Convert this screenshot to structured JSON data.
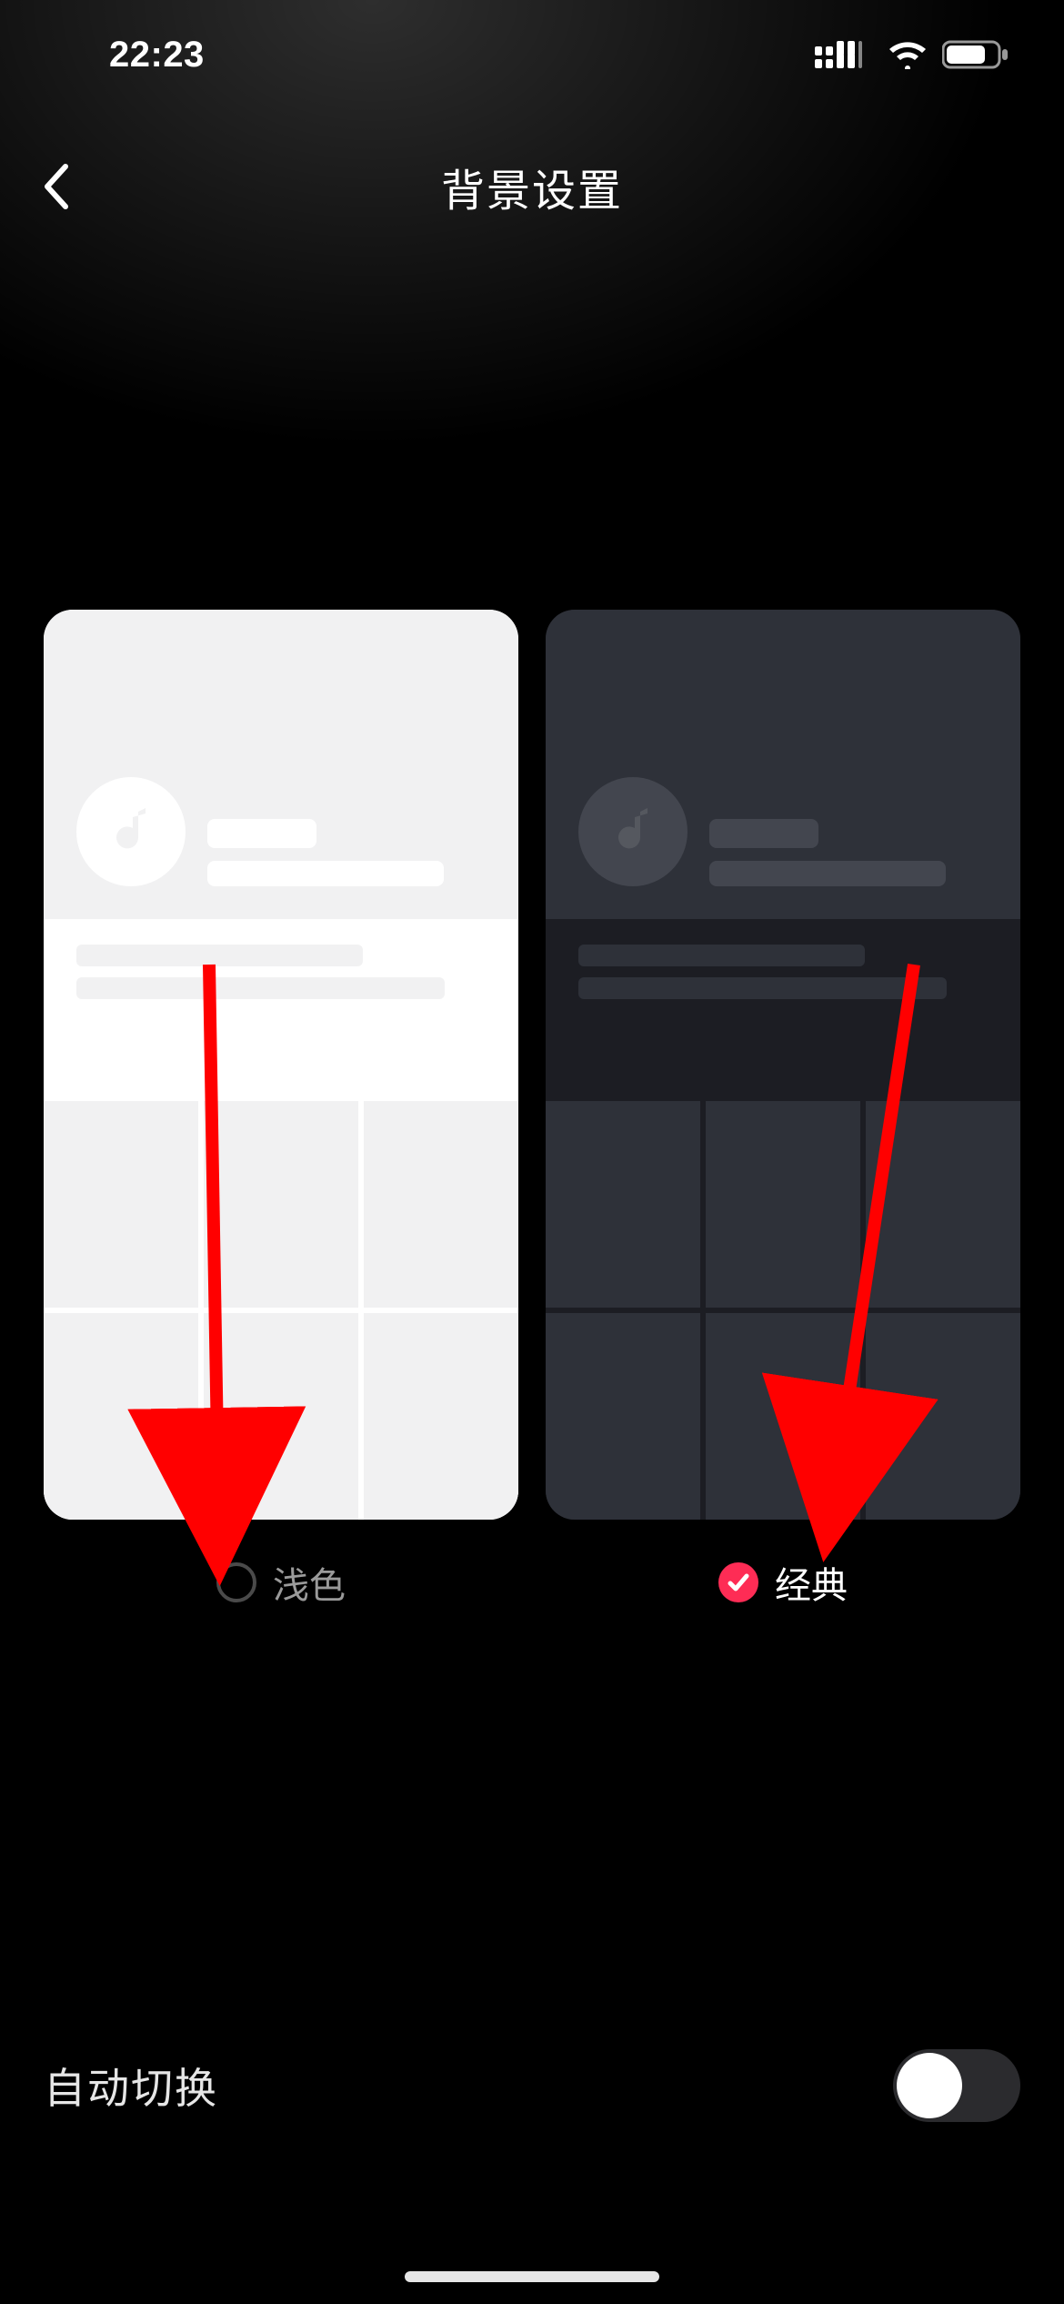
{
  "status": {
    "time": "22:23"
  },
  "header": {
    "title": "背景设置"
  },
  "themes": {
    "options": [
      {
        "key": "light",
        "label": "浅色",
        "selected": false
      },
      {
        "key": "dark",
        "label": "经典",
        "selected": true
      }
    ]
  },
  "auto_switch": {
    "label": "自动切换",
    "enabled": false
  },
  "colors": {
    "accent": "#fe2c55",
    "arrow": "#ff0000"
  }
}
